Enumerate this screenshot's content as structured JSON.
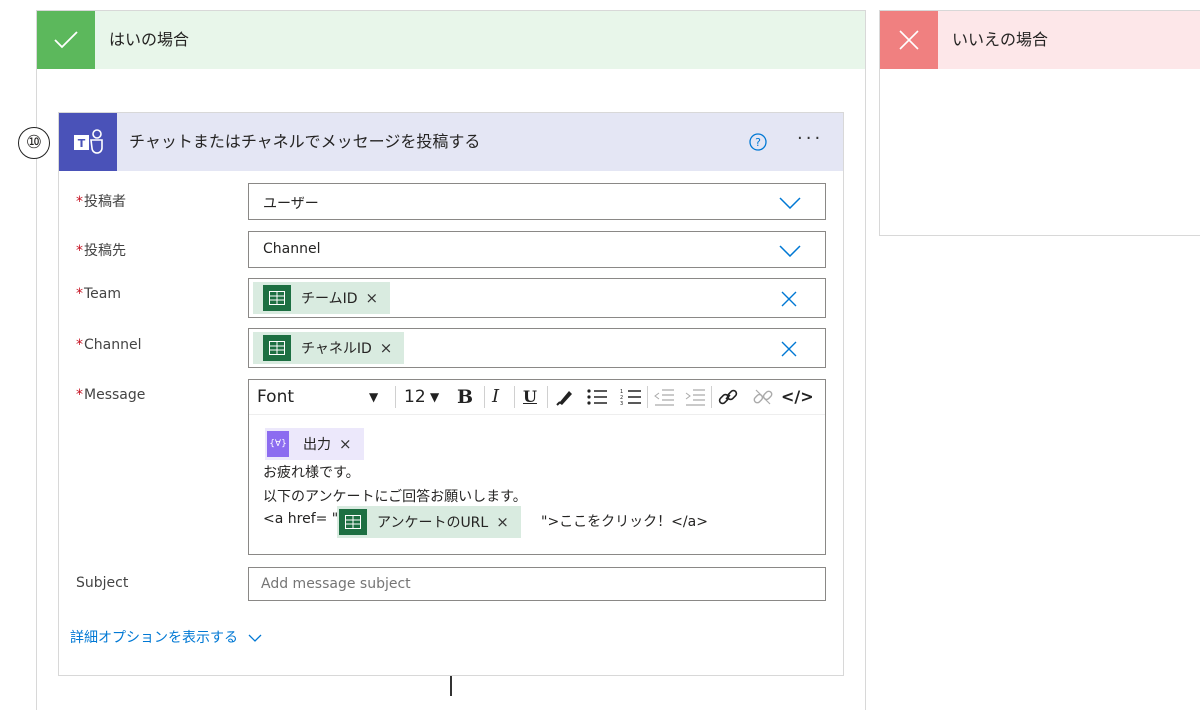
{
  "yes_branch": {
    "title": "はいの場合"
  },
  "no_branch": {
    "title": "いいえの場合"
  },
  "step": {
    "number": "⑩"
  },
  "action": {
    "title": "チャットまたはチャネルでメッセージを投稿する",
    "help_icon": "question-circle-icon",
    "more_label": "···"
  },
  "fields": {
    "poster": {
      "label": "投稿者",
      "value": "ユーザー",
      "required": "*"
    },
    "post_to": {
      "label": "投稿先",
      "value": "Channel",
      "required": "*"
    },
    "team": {
      "label": "Team",
      "token": "チームID",
      "required": "*"
    },
    "channel": {
      "label": "Channel",
      "token": "チャネルID",
      "required": "*"
    },
    "message": {
      "label": "Message",
      "required": "*",
      "toolbar": {
        "font": "Font",
        "size": "12",
        "bold": "B",
        "italic": "I",
        "underline": "U",
        "code": "</>"
      },
      "token_output": "出力",
      "token_output_icon": "{∀}",
      "line1": "お疲れ様です。",
      "line2": "以下のアンケートにご回答お願いします。",
      "line3_prefix": "<a href= \"",
      "token_url": "アンケートのURL",
      "line3_suffix": "\">ここをクリック！</a>"
    },
    "subject": {
      "label": "Subject",
      "placeholder": "Add message subject"
    }
  },
  "advanced_options": "詳細オプションを表示する",
  "token_remove": "×",
  "colors": {
    "accent": "#0078d4",
    "teams": "#4a52b8",
    "excel": "#1d6f42",
    "yes": "#5cb85c",
    "no": "#f08080"
  }
}
